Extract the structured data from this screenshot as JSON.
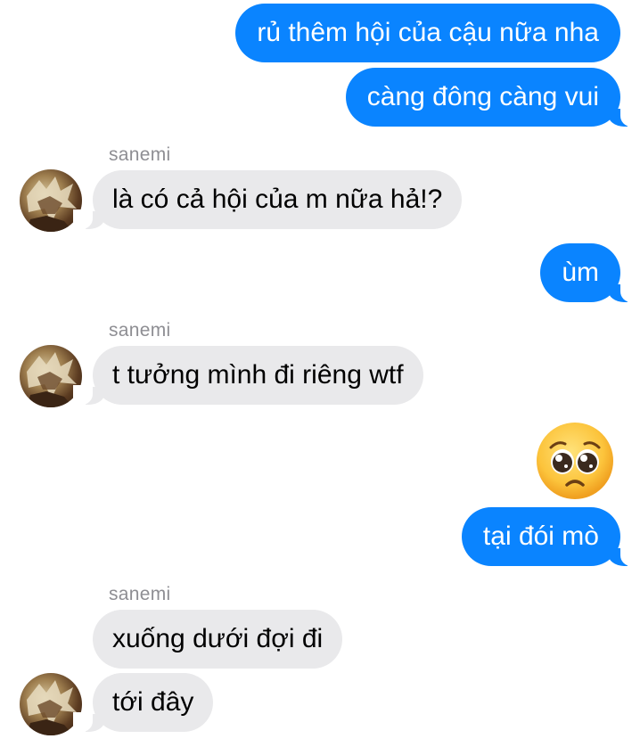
{
  "messages": [
    {
      "direction": "outgoing",
      "text": "rủ thêm hội của cậu nữa nha"
    },
    {
      "direction": "outgoing",
      "text": "càng đông càng vui"
    },
    {
      "direction": "incoming",
      "sender": "sanemi",
      "text": "là có cả hội của m nữa hả!?"
    },
    {
      "direction": "outgoing",
      "text": "ùm"
    },
    {
      "direction": "incoming",
      "sender": "sanemi",
      "text": "t tưởng mình đi riêng wtf"
    },
    {
      "direction": "outgoing",
      "emoji": "pleading-face-emoji"
    },
    {
      "direction": "outgoing",
      "text": "tại đói mò"
    },
    {
      "direction": "incoming",
      "sender": "sanemi",
      "text": "xuống dưới đợi đi"
    },
    {
      "direction": "incoming",
      "text": "tới đây"
    }
  ],
  "colors": {
    "outgoing_bubble": "#0a84ff",
    "incoming_bubble": "#e9e9eb",
    "sender_label": "#8e8e93"
  },
  "icons": {
    "avatar": "sanemi-avatar",
    "emoji": "pleading-face-emoji"
  }
}
